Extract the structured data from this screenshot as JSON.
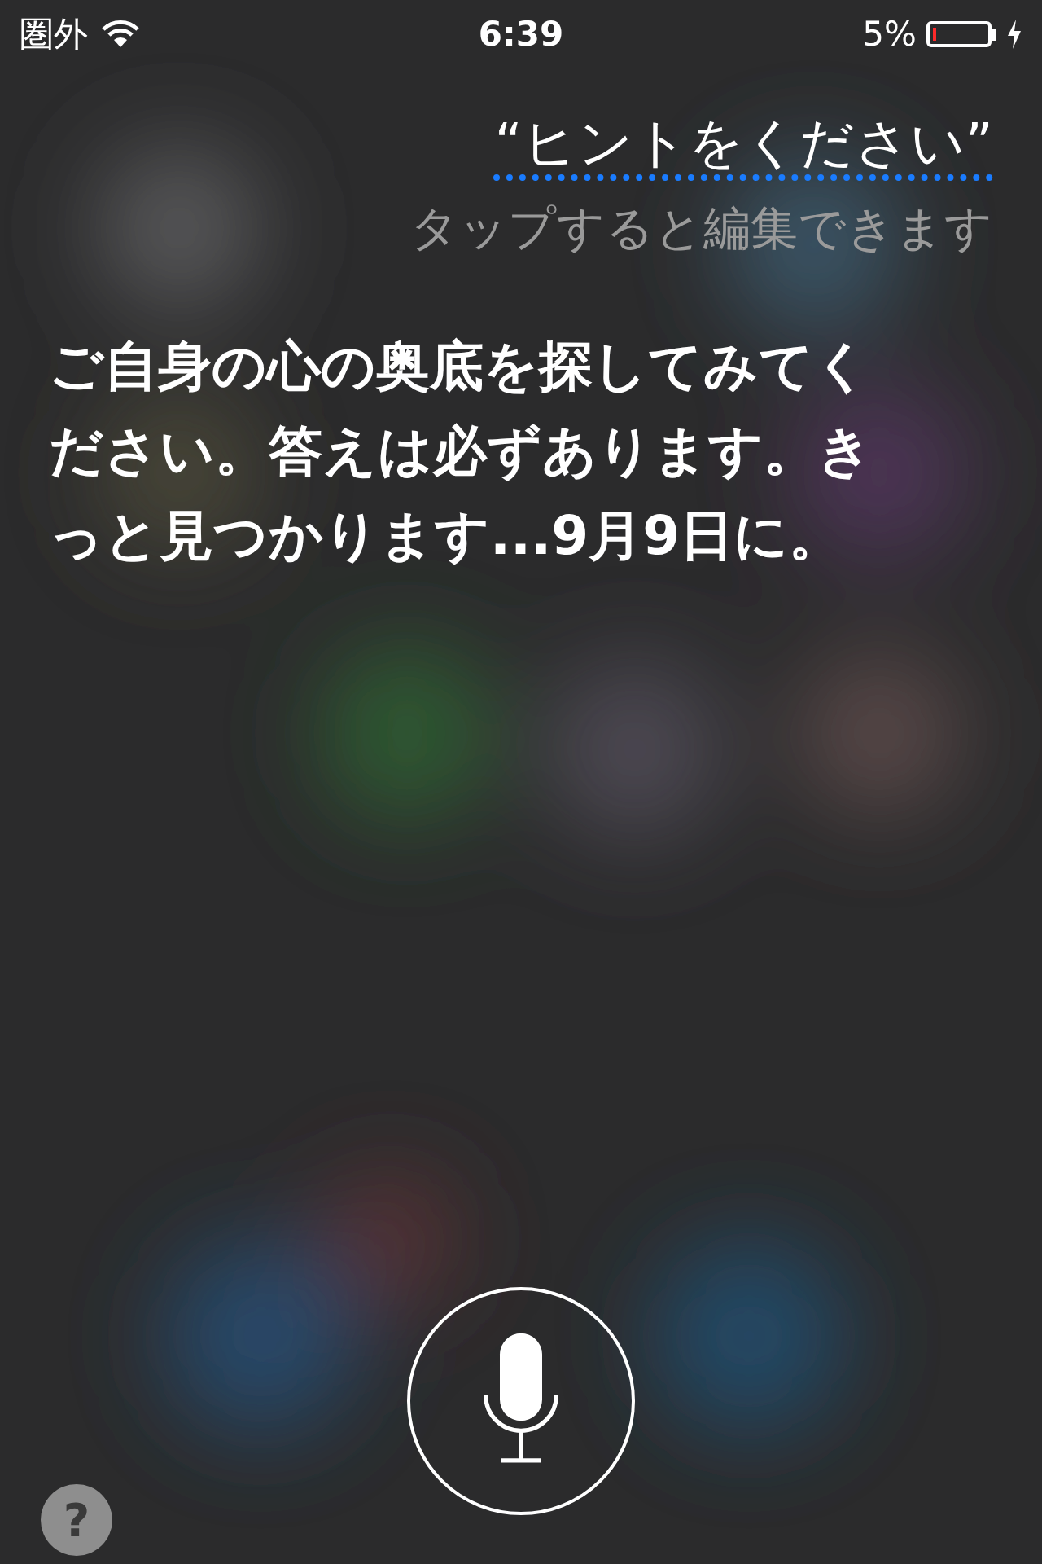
{
  "status_bar": {
    "carrier": "圏外",
    "time": "6:39",
    "battery_percent": "5%",
    "battery": {
      "level": 0.05,
      "charging": true
    }
  },
  "query": {
    "text": "“ヒントをください”",
    "hint": "タップすると編集できます"
  },
  "answer": "ご自身の心の奥底を探してみてください。答えは必ずあります。きっと見つかります...9月9日に。",
  "help_button": {
    "label": "?"
  }
}
